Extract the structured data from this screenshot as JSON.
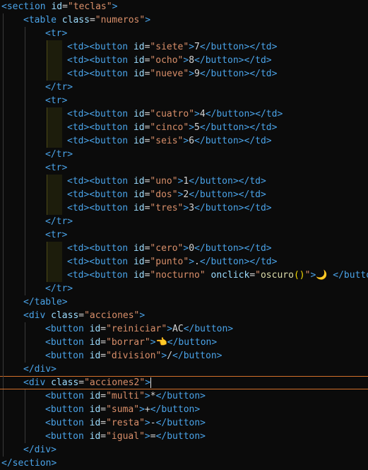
{
  "tokens": {
    "lt": "<",
    "gt": ">",
    "lt_slash": "</",
    "eq": "=",
    "q": "\"",
    "space": " "
  },
  "tags": {
    "section": "section",
    "table": "table",
    "tr": "tr",
    "td": "td",
    "button": "button",
    "div": "div"
  },
  "attrs": {
    "id": "id",
    "class": "class",
    "onclick": "onclick"
  },
  "values": {
    "teclas": "teclas",
    "numeros": "numeros",
    "acciones": "acciones",
    "acciones2": "acciones2"
  },
  "rows": [
    [
      {
        "id": "siete",
        "label": "7"
      },
      {
        "id": "ocho",
        "label": "8"
      },
      {
        "id": "nueve",
        "label": "9"
      }
    ],
    [
      {
        "id": "cuatro",
        "label": "4"
      },
      {
        "id": "cinco",
        "label": "5"
      },
      {
        "id": "seis",
        "label": "6"
      }
    ],
    [
      {
        "id": "uno",
        "label": "1"
      },
      {
        "id": "dos",
        "label": "2"
      },
      {
        "id": "tres",
        "label": "3"
      }
    ],
    [
      {
        "id": "cero",
        "label": "0"
      },
      {
        "id": "punto",
        "label": "."
      }
    ]
  ],
  "nocturno": {
    "id": "nocturno",
    "onclick_fn": "oscuro",
    "onclick_parens": "()",
    "label": "🌙",
    "trailing": "</buttor"
  },
  "acciones_buttons": [
    {
      "id": "reiniciar",
      "label": "AC"
    },
    {
      "id": "borrar",
      "label": "👈"
    },
    {
      "id": "division",
      "label": "/"
    }
  ],
  "acciones2_buttons": [
    {
      "id": "multi",
      "label": "*"
    },
    {
      "id": "suma",
      "label": "+"
    },
    {
      "id": "resta",
      "label": "-"
    },
    {
      "id": "igual",
      "label": "="
    }
  ]
}
